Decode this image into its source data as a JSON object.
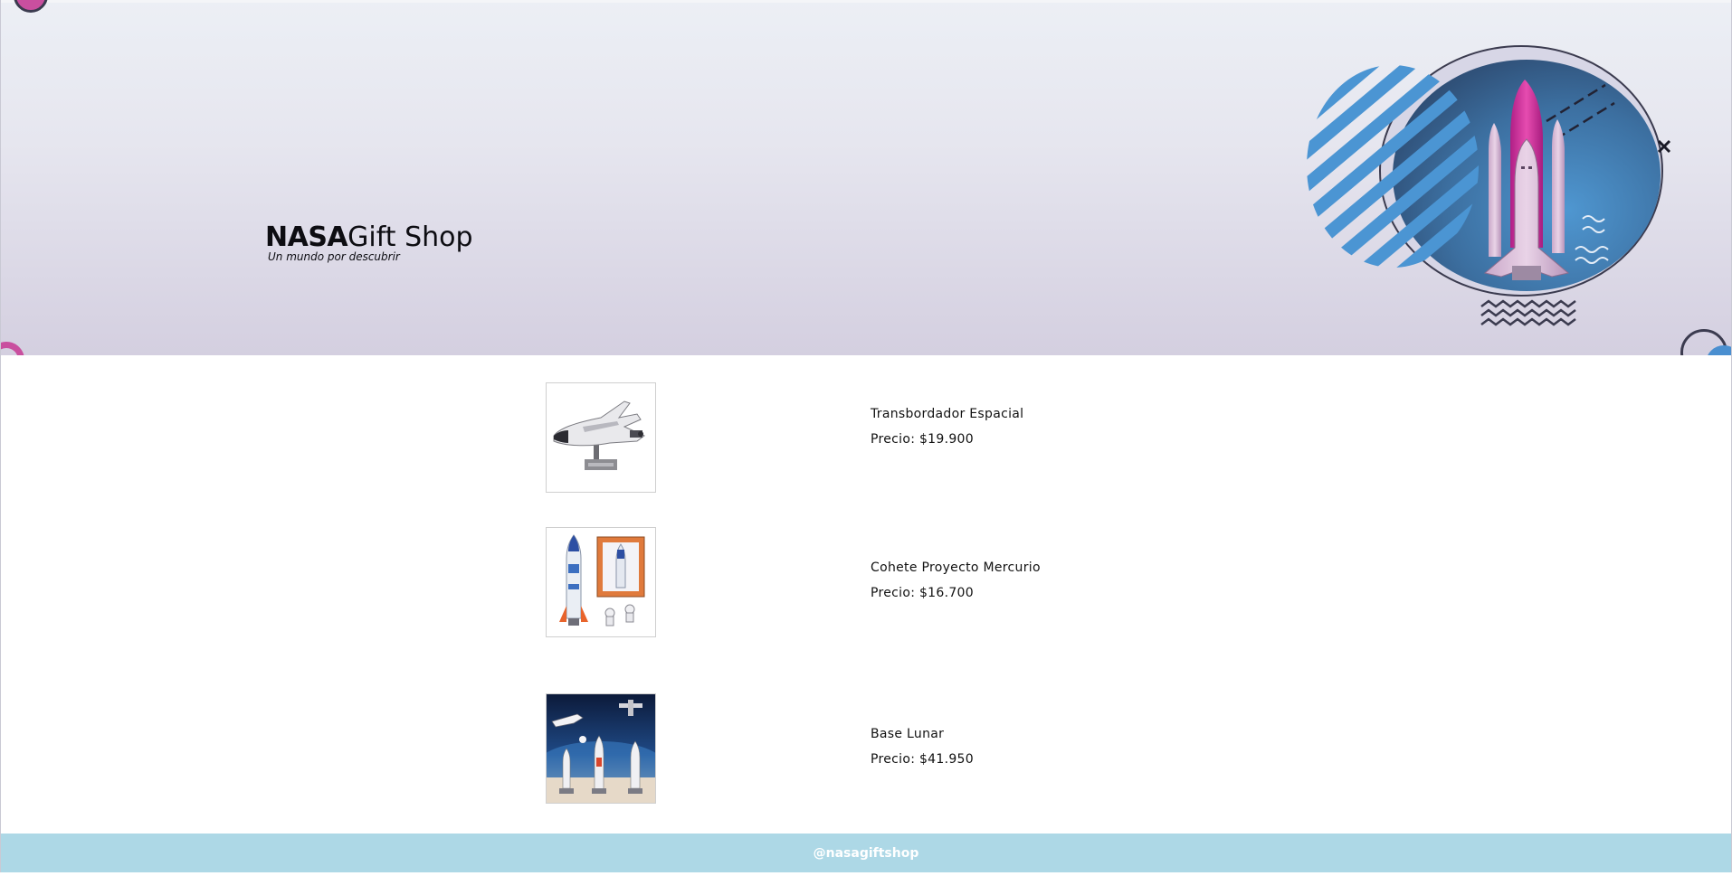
{
  "brand": {
    "name_strong": "NASA",
    "name_light": "Gift Shop",
    "tagline": "Un mundo por descubrir"
  },
  "products": [
    {
      "name": "Transbordador Espacial",
      "price": "Precio: $19.900",
      "image_icon": "space-shuttle-model-image"
    },
    {
      "name": "Cohete Proyecto Mercurio",
      "price": "Precio: $16.700",
      "image_icon": "rocket-toy-set-image"
    },
    {
      "name": "Base Lunar",
      "price": "Precio: $41.950",
      "image_icon": "lunar-base-toy-image"
    }
  ],
  "footer": {
    "handle": "@nasagiftshop"
  },
  "colors": {
    "footer_bg": "#add8e6",
    "accent_pink": "#c94f9f",
    "accent_blue": "#4a8fd0",
    "dark_line": "#3b3b4f"
  }
}
